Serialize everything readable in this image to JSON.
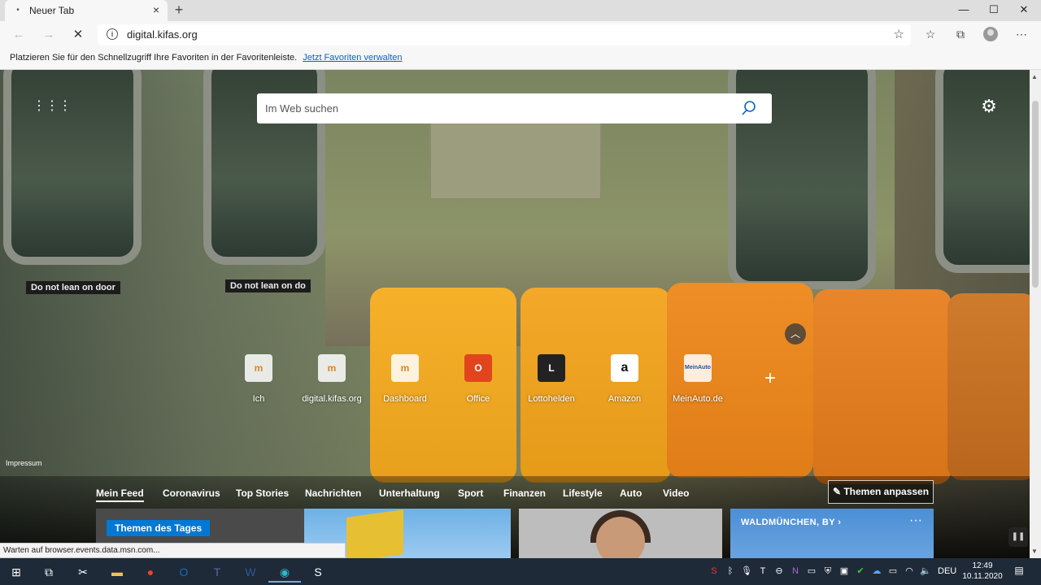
{
  "browser": {
    "tab_title": "Neuer Tab",
    "url": "digital.kifas.org",
    "favbar_hint": "Platzieren Sie für den Schnellzugriff Ihre Favoriten in der Favoritenleiste.",
    "favbar_link": "Jetzt Favoriten verwalten",
    "status_text": "Warten auf browser.events.data.msn.com..."
  },
  "newtab": {
    "search_placeholder": "Im Web suchen",
    "impressum": "Impressum",
    "stickers": [
      "Do not lean on door",
      "Do not lean on do"
    ],
    "quicklinks": [
      {
        "label": "Ich",
        "icon": "m"
      },
      {
        "label": "digital.kifas.org",
        "icon": "m"
      },
      {
        "label": "Dashboard",
        "icon": "m"
      },
      {
        "label": "Office",
        "icon": "O"
      },
      {
        "label": "Lottohelden",
        "icon": "L"
      },
      {
        "label": "Amazon",
        "icon": "a"
      },
      {
        "label": "MeinAuto.de",
        "icon": "MeinAuto"
      }
    ],
    "feed_tabs": [
      "Mein Feed",
      "Coronavirus",
      "Top Stories",
      "Nachrichten",
      "Unterhaltung",
      "Sport",
      "Finanzen",
      "Lifestyle",
      "Auto",
      "Video"
    ],
    "themen_button": "Themen anpassen",
    "card_tag": "Themen des Tages",
    "weather_location": "WALDMÜNCHEN, BY"
  },
  "taskbar": {
    "language": "DEU",
    "time": "12:49",
    "date": "10.11.2020"
  },
  "colors": {
    "accent": "#0078d4",
    "link": "#0a63c4"
  }
}
